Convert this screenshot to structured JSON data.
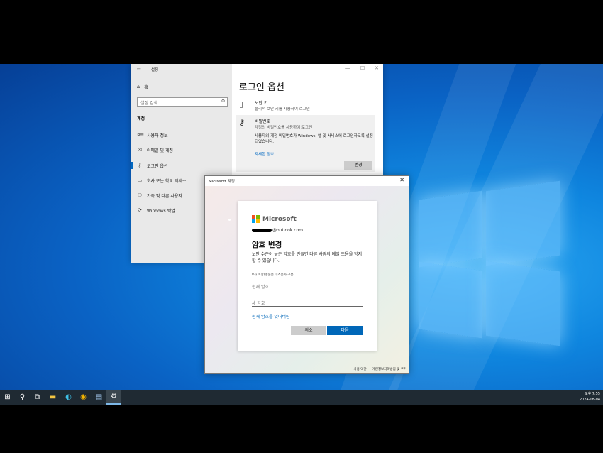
{
  "settings": {
    "window_title": "설정",
    "back_glyph": "←",
    "controls": [
      "—",
      "☐",
      "✕"
    ],
    "home_label": "홈",
    "search_placeholder": "설정 검색",
    "section_label": "계정",
    "nav": [
      {
        "label": "사용자 정보",
        "icon": "person-card-icon",
        "glyph": "ᴙ≡"
      },
      {
        "label": "이메일 및 계정",
        "icon": "mail-icon",
        "glyph": "✉"
      },
      {
        "label": "로그인 옵션",
        "icon": "key-icon",
        "glyph": "⚷"
      },
      {
        "label": "회사 또는 학교 액세스",
        "icon": "briefcase-icon",
        "glyph": "▭"
      },
      {
        "label": "가족 및 다른 사용자",
        "icon": "people-icon",
        "glyph": "⚇"
      },
      {
        "label": "Windows 백업",
        "icon": "sync-icon",
        "glyph": "⟳"
      }
    ],
    "page_title": "로그인 옵션",
    "security_key": {
      "title": "보안 키",
      "subtitle": "물리적 보안 키를 사용하여 로그인"
    },
    "password": {
      "title": "비밀번호",
      "subtitle": "계정의 비밀번호를 사용하여 로그인",
      "description": "사용자의 계정 비밀번호가 Windows, 앱 및 서비스에 로그인하도록 설정되었습니다.",
      "learn_more": "자세한 정보",
      "change_button": "변경"
    }
  },
  "account_dialog": {
    "window_title": "Microsoft 계정",
    "close_glyph": "✕",
    "brand": "Microsoft",
    "email_suffix": "@outlook.com",
    "heading": "암호 변경",
    "body": "보안 수준이 높은 암호를 만들면 다른 사람의 메일 도용을 방지할 수 있습니다.",
    "hint": "8자 이상(영문은 대소문자 구분)",
    "current_password_placeholder": "현재 암호",
    "new_password_placeholder": "새 암호",
    "forgot_link": "현재 암호를 잊어버림",
    "cancel_button": "취소",
    "next_button": "다음",
    "footer_terms": "사용 약관",
    "footer_privacy": "개인정보처리방침 및 쿠키"
  },
  "taskbar": {
    "time": "오후 7:55",
    "date": "2024-08-04"
  },
  "colors": {
    "accent": "#0067b8",
    "ms_red": "#f25022",
    "ms_green": "#7fba00",
    "ms_blue": "#00a4ef",
    "ms_yellow": "#ffb900"
  }
}
